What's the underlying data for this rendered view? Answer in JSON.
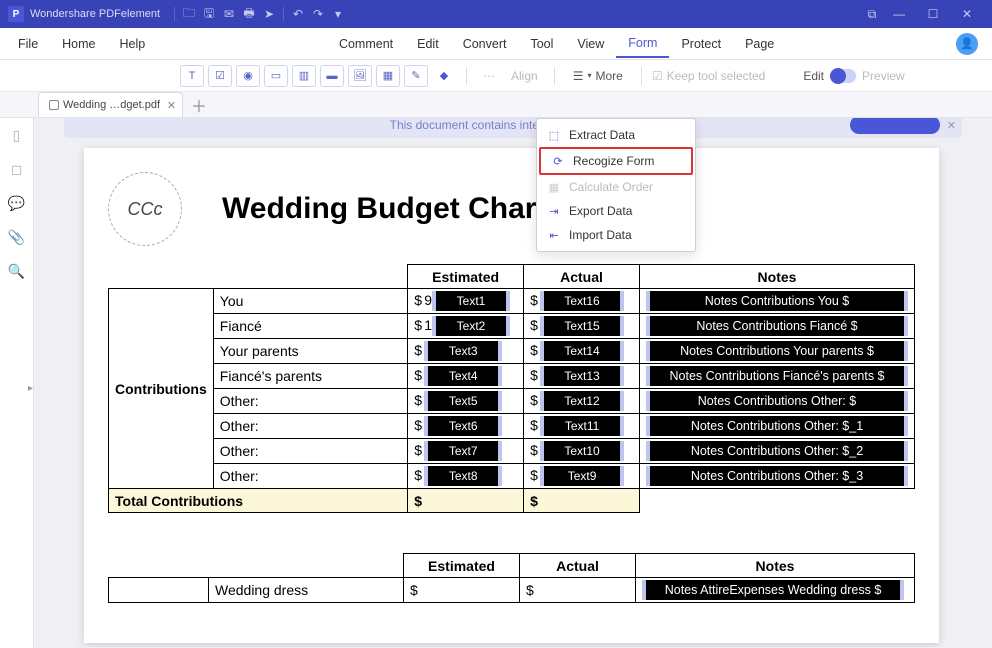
{
  "app": {
    "name": "Wondershare PDFelement"
  },
  "menubar": {
    "file": "File",
    "home": "Home",
    "help": "Help",
    "comment": "Comment",
    "edit": "Edit",
    "convert": "Convert",
    "tool": "Tool",
    "view": "View",
    "form": "Form",
    "protect": "Protect",
    "page": "Page"
  },
  "toolbar": {
    "align": "Align",
    "more": "More",
    "keep_tool": "Keep tool selected",
    "edit": "Edit",
    "preview": "Preview"
  },
  "tab": {
    "name": "Wedding …dget.pdf"
  },
  "banner": {
    "text": "This document contains interactive form fields."
  },
  "dropdown": {
    "extract": "Extract Data",
    "recognize": "Recogize Form",
    "calculate": "Calculate Order",
    "export": "Export Data",
    "import": "Import Data"
  },
  "doc": {
    "title": "Wedding Budget Chart",
    "headers": {
      "estimated": "Estimated",
      "actual": "Actual",
      "notes": "Notes"
    },
    "section1": {
      "category": "Contributions",
      "rows": [
        {
          "label": "You",
          "est_lead": "9",
          "est": "Text1",
          "act": "Text16",
          "notes": "Notes Contributions You $"
        },
        {
          "label": "Fiancé",
          "est_lead": "1",
          "est": "Text2",
          "act": "Text15",
          "notes": "Notes Contributions Fiancé $"
        },
        {
          "label": "Your parents",
          "est_lead": "",
          "est": "Text3",
          "act": "Text14",
          "notes": "Notes Contributions Your parents $"
        },
        {
          "label": "Fiancé's parents",
          "est_lead": "",
          "est": "Text4",
          "act": "Text13",
          "notes": "Notes Contributions Fiancé's parents $"
        },
        {
          "label": "Other:",
          "est_lead": "",
          "est": "Text5",
          "act": "Text12",
          "notes": "Notes Contributions Other: $"
        },
        {
          "label": "Other:",
          "est_lead": "",
          "est": "Text6",
          "act": "Text11",
          "notes": "Notes Contributions Other: $_1"
        },
        {
          "label": "Other:",
          "est_lead": "",
          "est": "Text7",
          "act": "Text10",
          "notes": "Notes Contributions Other: $_2"
        },
        {
          "label": "Other:",
          "est_lead": "",
          "est": "Text8",
          "act": "Text9",
          "notes": "Notes Contributions Other: $_3"
        }
      ],
      "total_label": "Total Contributions",
      "total_est": "$",
      "total_act": "$"
    },
    "section2": {
      "row": {
        "label": "Wedding dress",
        "est": "$",
        "act": "$",
        "notes": "Notes AttireExpenses Wedding dress $"
      }
    }
  }
}
